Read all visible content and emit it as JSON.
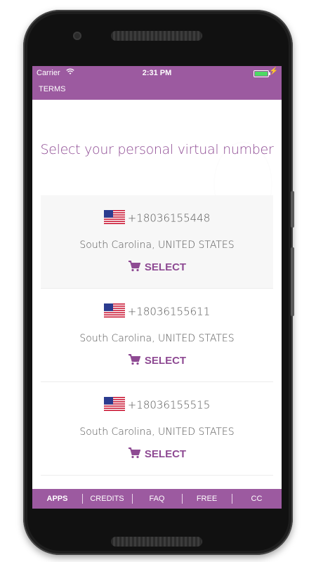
{
  "status_bar": {
    "carrier": "Carrier",
    "time": "2:31 PM",
    "battery_level": 1.0
  },
  "nav": {
    "terms": "TERMS"
  },
  "heading": "Select your personal virtual number",
  "numbers": [
    {
      "number": "+18036155448",
      "location": "South Carolina, UNITED STATES",
      "action": "SELECT"
    },
    {
      "number": "+18036155611",
      "location": "South Carolina, UNITED STATES",
      "action": "SELECT"
    },
    {
      "number": "+18036155515",
      "location": "South Carolina, UNITED STATES",
      "action": "SELECT"
    }
  ],
  "tabs": [
    {
      "label": "APPS",
      "active": true
    },
    {
      "label": "CREDITS",
      "active": false
    },
    {
      "label": "FAQ",
      "active": false
    },
    {
      "label": "FREE",
      "active": false
    },
    {
      "label": "CC",
      "active": false
    }
  ],
  "colors": {
    "primary": "#9c5aa0",
    "accent_text": "#8e4a93",
    "battery": "#4cd964"
  },
  "icons": {
    "wifi": "wifi-icon",
    "bolt": "charging-bolt-icon",
    "cart": "shopping-cart-icon",
    "flag": "us-flag-icon"
  }
}
